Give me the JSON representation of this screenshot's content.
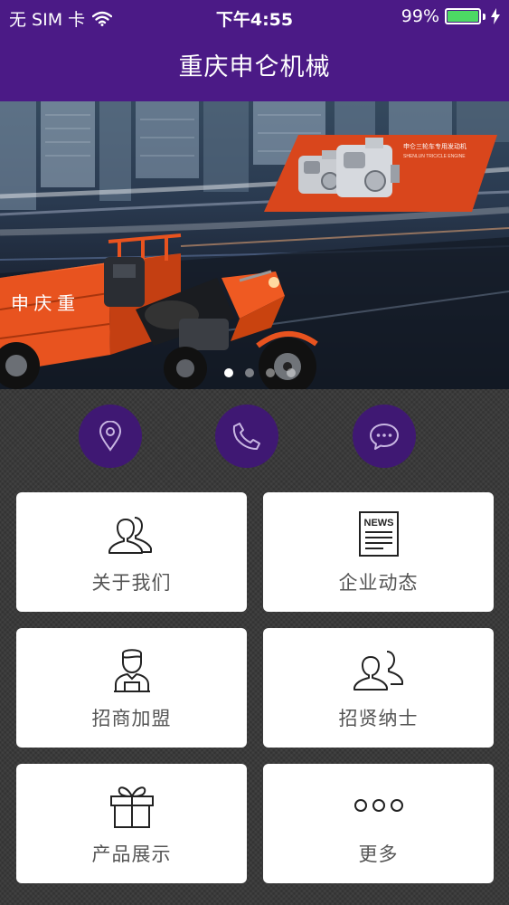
{
  "status_bar": {
    "carrier": "无 SIM 卡",
    "time": "下午4:55",
    "battery": "99%",
    "battery_level": 0.99
  },
  "nav": {
    "title": "重庆申仑机械"
  },
  "banner": {
    "engine_caption": "申仑三轮车专用发动机",
    "engine_caption_en": "SHENLUN TRIC/CLE ENGINE",
    "truck_lettering": "申 庆 重",
    "slide_count": 4,
    "active_slide": 1
  },
  "quick_actions": [
    {
      "icon": "location-pin-icon"
    },
    {
      "icon": "phone-icon"
    },
    {
      "icon": "chat-bubble-icon"
    }
  ],
  "menu": {
    "about": "关于我们",
    "news": "企业动态",
    "news_icon_text": "NEWS",
    "franchise": "招商加盟",
    "recruit": "招贤纳士",
    "products": "产品展示",
    "more": "更多"
  },
  "colors": {
    "header": "#4b1a86",
    "quick_button": "#3f1873",
    "truck": "#e8531f",
    "card": "#ffffff"
  }
}
